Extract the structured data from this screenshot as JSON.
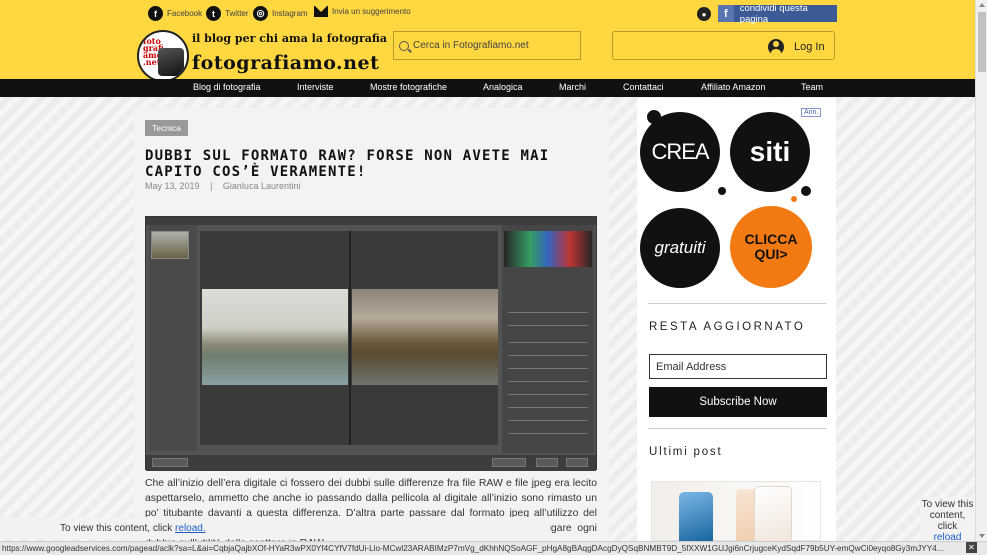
{
  "topbar": {
    "social": [
      {
        "icon": "facebook-icon",
        "label": "Facebook"
      },
      {
        "icon": "twitter-icon",
        "label": "Twitter"
      },
      {
        "icon": "instagram-icon",
        "label": "Instagram"
      },
      {
        "icon": "envelope-icon",
        "label": "Invia un suggerimento"
      }
    ],
    "share_label": "condividi questa pagina"
  },
  "header": {
    "logo_text": "foto grafi amo .net",
    "tagline": "il blog per chi ama la fotografia",
    "logotype": "fotografiamo.net",
    "search_placeholder": "Cerca in Fotografiamo.net",
    "login_label": "Log In"
  },
  "nav": [
    "Blog di fotografia",
    "Interviste",
    "Mostre fotografiche",
    "Analogica",
    "Marchi",
    "Contattaci",
    "Affiliato Amazon",
    "Team"
  ],
  "article": {
    "category": "Tecnica",
    "title": "Dubbi sul formato RAW? Forse non avete mai capito cos’è veramente!",
    "date": "May 13, 2019",
    "separator": "|",
    "author": "Gianluca Laurentini",
    "body": "Che all’inizio dell’era digitale ci fossero dei dubbi sulle differenze fra file RAW e file jpeg era lecito aspettarselo, ammetto che anche io passando dalla pellicola al digitale all’inizio sono rimasto un po’ titubante davanti a questa differenza. D’altra parte passare dal formato jpeg all’utilizzo del computer appariva naturale, ma è stato necessario dare alcune spiegazioni per fugare ogni dubbio sull’utilità dello scattare in RAW."
  },
  "sidebar": {
    "ad_badge": "Ann.",
    "bubbles": [
      "CREA",
      "siti",
      "gratuiti",
      "CLICCA QUI>"
    ],
    "newsletter_heading": "RESTA AGGIORNATO",
    "email_placeholder": "Email Address",
    "subscribe_label": "Subscribe Now",
    "recent_heading": "Ultimi post"
  },
  "overlays": {
    "blocked_text": "To view this content, click",
    "blocked_link": "reload.",
    "blocked_right_text": "To view this content, click",
    "blocked_right_link": "reload"
  },
  "statusbar": {
    "url": "https://www.googleadservices.com/pagead/aclk?sa=L&ai=CqbjaQajbXOf-HYaR3wPX0Yf4CYfV7fdUi-Llo-MCwl23ARABIMzP7mVg_dKhhNQSoAGF_pHgA8gBAqgDAcgDyQSqBNMBT9D_5fXXW1GUJgi6nCrjugceKydSqdF79b5UY-emQwCi0eyqo8Gy3mJYY4..."
  },
  "colors": {
    "brand_yellow": "#ffd740",
    "nav_black": "#111111",
    "facebook_blue": "#3b5a96",
    "ad_orange": "#f37a12"
  }
}
